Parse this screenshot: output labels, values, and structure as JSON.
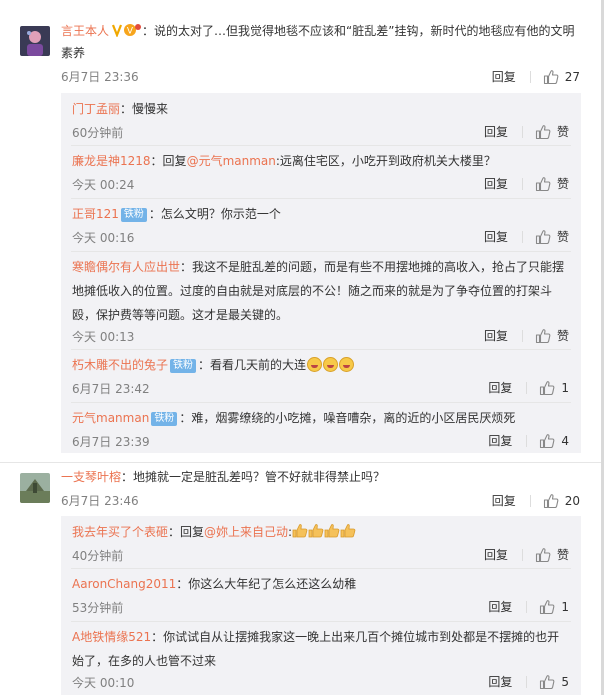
{
  "comments": [
    {
      "user": "言王本人",
      "text": "：说的太对了…但我觉得地毯不应该和“脏乱差”挂钩，新时代的地毯应有他的文明",
      "text2": "素养",
      "time": "6月7日 23:36",
      "reply_label": "回复",
      "likes": "27",
      "replies": [
        {
          "user": "门丁孟丽",
          "text": "：慢慢来",
          "time": "60分钟前",
          "reply_label": "回复",
          "like_label": "赞"
        },
        {
          "user": "廉龙是神1218",
          "prefix": "：回复",
          "mention": "@元气manman",
          "text": ":远离住宅区，小吃开到政府机关大楼里？",
          "time": "今天 00:24",
          "reply_label": "回复",
          "like_label": "赞"
        },
        {
          "user": "正哥121",
          "badge": "铁粉",
          "text": "：怎么文明？你示范一个",
          "time": "今天 00:16",
          "reply_label": "回复",
          "like_label": "赞"
        },
        {
          "user": "寒瞻偶尔有人应出世",
          "text": "：我这不是脏乱差的问题，而是有些不用摆地摊的高收入，抢占了只能摆",
          "text2": "地摊低收入的位置。过度的自由就是对底层的不公！随之而来的就是为了争夺位置的打架斗",
          "text3": "殴，保护费等等问题。这才是最关键的。",
          "time": "今天 00:13",
          "reply_label": "回复",
          "like_label": "赞"
        },
        {
          "user": "朽木雕不出的兔子",
          "badge": "铁粉",
          "text": "：看看几天前的大连",
          "time": "6月7日 23:42",
          "reply_label": "回复",
          "likes": "1"
        },
        {
          "user": "元气manman",
          "badge": "铁粉",
          "text": "：难，烟雾缭绕的小吃摊，噪音嘈杂，离的近的小区居民厌烦死",
          "time": "6月7日 23:39",
          "reply_label": "回复",
          "likes": "4"
        }
      ]
    },
    {
      "user": "一支琴叶榕",
      "text": "：地摊就一定是脏乱差吗？管不好就非得禁止吗？",
      "time": "6月7日 23:46",
      "reply_label": "回复",
      "likes": "20",
      "replies": [
        {
          "user": "我去年买了个表砸",
          "prefix": "：回复",
          "mention": "@妳上来自己动",
          "text": ":",
          "time": "40分钟前",
          "reply_label": "回复",
          "like_label": "赞"
        },
        {
          "user": "AaronChang2011",
          "text": "：你这么大年纪了怎么还这么幼稚",
          "time": "53分钟前",
          "reply_label": "回复",
          "likes": "1"
        },
        {
          "user": "A地铁情缘521",
          "text": "：你试试自从让摆摊我家这一晚上出来几百个摊位城市到处都是不摆摊的也开",
          "text2": "始了，在多的人也管不过来",
          "time": "今天 00:10",
          "reply_label": "回复",
          "likes": "5"
        }
      ]
    }
  ],
  "icons": {
    "like": "thumbs-up-icon",
    "vip": "vip-badge-icon",
    "emoji": "laughing-emoji-icon",
    "thumb_emoji": "thumbs-up-emoji-icon"
  },
  "colors": {
    "name": "#eb7350",
    "reply_bg": "#f2f2f5",
    "badge": "#73b3e8"
  }
}
